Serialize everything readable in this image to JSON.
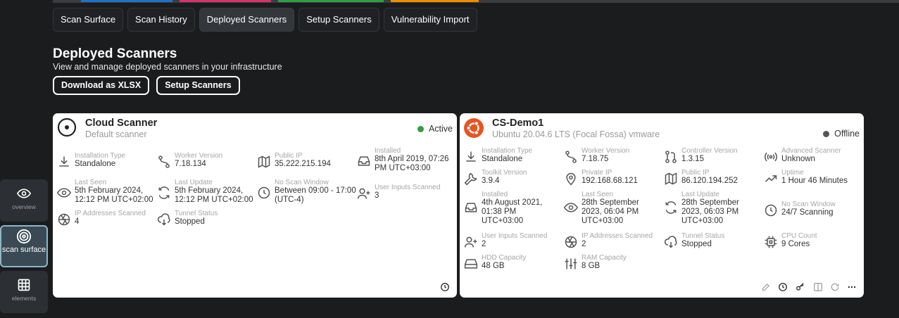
{
  "tabs": [
    "Scan Surface",
    "Scan History",
    "Deployed Scanners",
    "Setup Scanners",
    "Vulnerability Import"
  ],
  "page": {
    "title": "Deployed Scanners",
    "subtitle": "View and manage deployed scanners in your infrastructure",
    "download_label": "Download as XLSX",
    "setup_label": "Setup Scanners"
  },
  "rail": {
    "overview": "overview",
    "scan_surface": "scan surface",
    "elements": "elements"
  },
  "colors": {
    "active": "#2f9e44",
    "offline": "#555555",
    "ubuntu": "#e95420"
  },
  "card1": {
    "title": "Cloud Scanner",
    "subtitle": "Default scanner",
    "status": "Active",
    "fields": {
      "install_type": {
        "label": "Installation Type",
        "value": "Standalone"
      },
      "worker_version": {
        "label": "Worker Version",
        "value": "7.18.134"
      },
      "public_ip": {
        "label": "Public IP",
        "value": "35.222.215.194"
      },
      "installed": {
        "label": "Installed",
        "value": "8th April 2019, 07:26 PM UTC+03:00"
      },
      "last_seen": {
        "label": "Last Seen",
        "value": "5th February 2024, 12:12 PM UTC+02:00"
      },
      "last_update": {
        "label": "Last Update",
        "value": "5th February 2024, 12:12 PM UTC+02:00"
      },
      "scan_window": {
        "label": "No Scan Window",
        "value": "Between 09:00 - 17:00 (UTC-4)"
      },
      "user_inputs": {
        "label": "User Inputs Scanned",
        "value": "3"
      },
      "ip_scanned": {
        "label": "IP Addresses Scanned",
        "value": "4"
      },
      "tunnel": {
        "label": "Tunnel Status",
        "value": "Stopped"
      }
    }
  },
  "card2": {
    "title": "CS-Demo1",
    "subtitle": "Ubuntu 20.04.6 LTS (Focal Fossa) vmware",
    "status": "Offline",
    "fields": {
      "install_type": {
        "label": "Installation Type",
        "value": "Standalone"
      },
      "worker_version": {
        "label": "Worker Version",
        "value": "7.18.75"
      },
      "controller_version": {
        "label": "Controller Version",
        "value": "1.3.15"
      },
      "advanced": {
        "label": "Advanced Scanner",
        "value": "Unknown"
      },
      "toolkit": {
        "label": "Toolkit Version",
        "value": "3.9.4"
      },
      "private_ip": {
        "label": "Private IP",
        "value": "192.168.68.121"
      },
      "public_ip": {
        "label": "Public IP",
        "value": "86.120.194.252"
      },
      "uptime": {
        "label": "Uptime",
        "value": "1 Hour 46 Minutes"
      },
      "installed": {
        "label": "Installed",
        "value": "4th August 2021, 01:38 PM UTC+03:00"
      },
      "last_seen": {
        "label": "Last Seen",
        "value": "28th September 2023, 06:04 PM UTC+03:00"
      },
      "last_update": {
        "label": "Last Update",
        "value": "28th September 2023, 06:03 PM UTC+03:00"
      },
      "scan_window": {
        "label": "No Scan Window",
        "value": "24/7 Scanning"
      },
      "user_inputs": {
        "label": "User Inputs Scanned",
        "value": "2"
      },
      "ip_scanned": {
        "label": "IP Addresses Scanned",
        "value": "2"
      },
      "tunnel": {
        "label": "Tunnel Status",
        "value": "Stopped"
      },
      "cpu": {
        "label": "CPU Count",
        "value": "9 Cores"
      },
      "hdd": {
        "label": "HDD Capacity",
        "value": "48 GB"
      },
      "ram": {
        "label": "RAM Capacity",
        "value": "8 GB"
      }
    }
  }
}
